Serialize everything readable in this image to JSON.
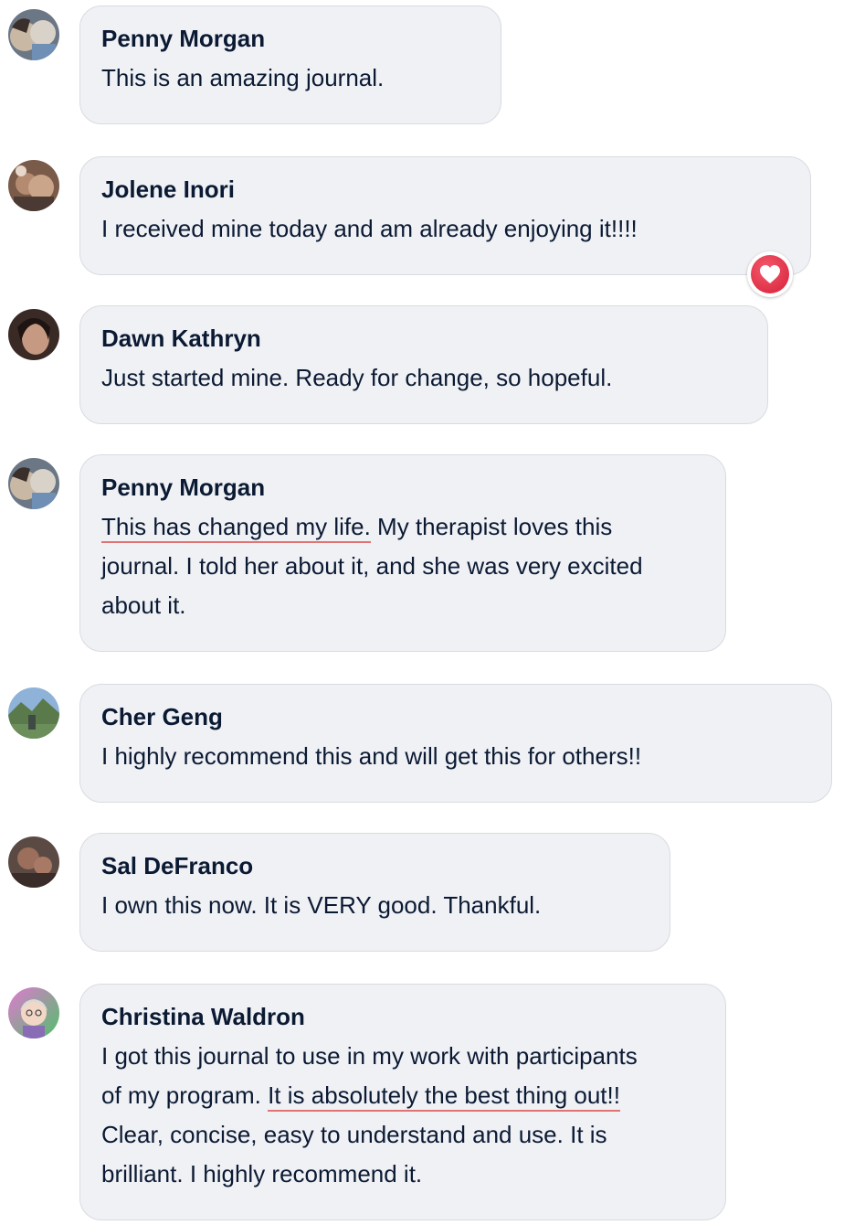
{
  "comments": [
    {
      "author": "Penny Morgan",
      "avatar_icon": "profile-photo-avatar",
      "lines": [
        "This is an amazing journal."
      ]
    },
    {
      "author": "Jolene Inori",
      "avatar_icon": "profile-photo-avatar",
      "lines": [
        "I received mine today and am already enjoying it!!!!"
      ],
      "reaction": "heart-icon"
    },
    {
      "author": "Dawn Kathryn",
      "avatar_icon": "profile-photo-avatar",
      "lines": [
        "Just started mine. Ready for change, so hopeful."
      ]
    },
    {
      "author": "Penny Morgan",
      "avatar_icon": "profile-photo-avatar",
      "highlight": "This has changed my life.",
      "after_highlight": " My therapist loves this",
      "lines": [
        "journal. I told her about it, and she was very excited",
        "about it."
      ]
    },
    {
      "author": "Cher Geng",
      "avatar_icon": "profile-photo-avatar",
      "lines": [
        "I highly recommend this and will get this for others!!"
      ]
    },
    {
      "author": "Sal DeFranco",
      "avatar_icon": "profile-photo-avatar",
      "lines": [
        "I own this now. It is VERY good. Thankful."
      ]
    },
    {
      "author": "Christina Waldron",
      "avatar_icon": "profile-photo-avatar",
      "line1": "I got this journal to use in my work with participants",
      "line2_before": "of my program. ",
      "highlight": "It is absolutely the best thing out!!",
      "lines": [
        "Clear, concise, easy to understand and use. It is",
        "brilliant. I highly recommend it."
      ]
    }
  ],
  "colors": {
    "bubble_bg": "#f0f1f5",
    "bubble_border": "#d9dbe1",
    "text": "#0b1a33",
    "highlight_underline": "#e27373",
    "reaction_heart": "#e0284a"
  }
}
